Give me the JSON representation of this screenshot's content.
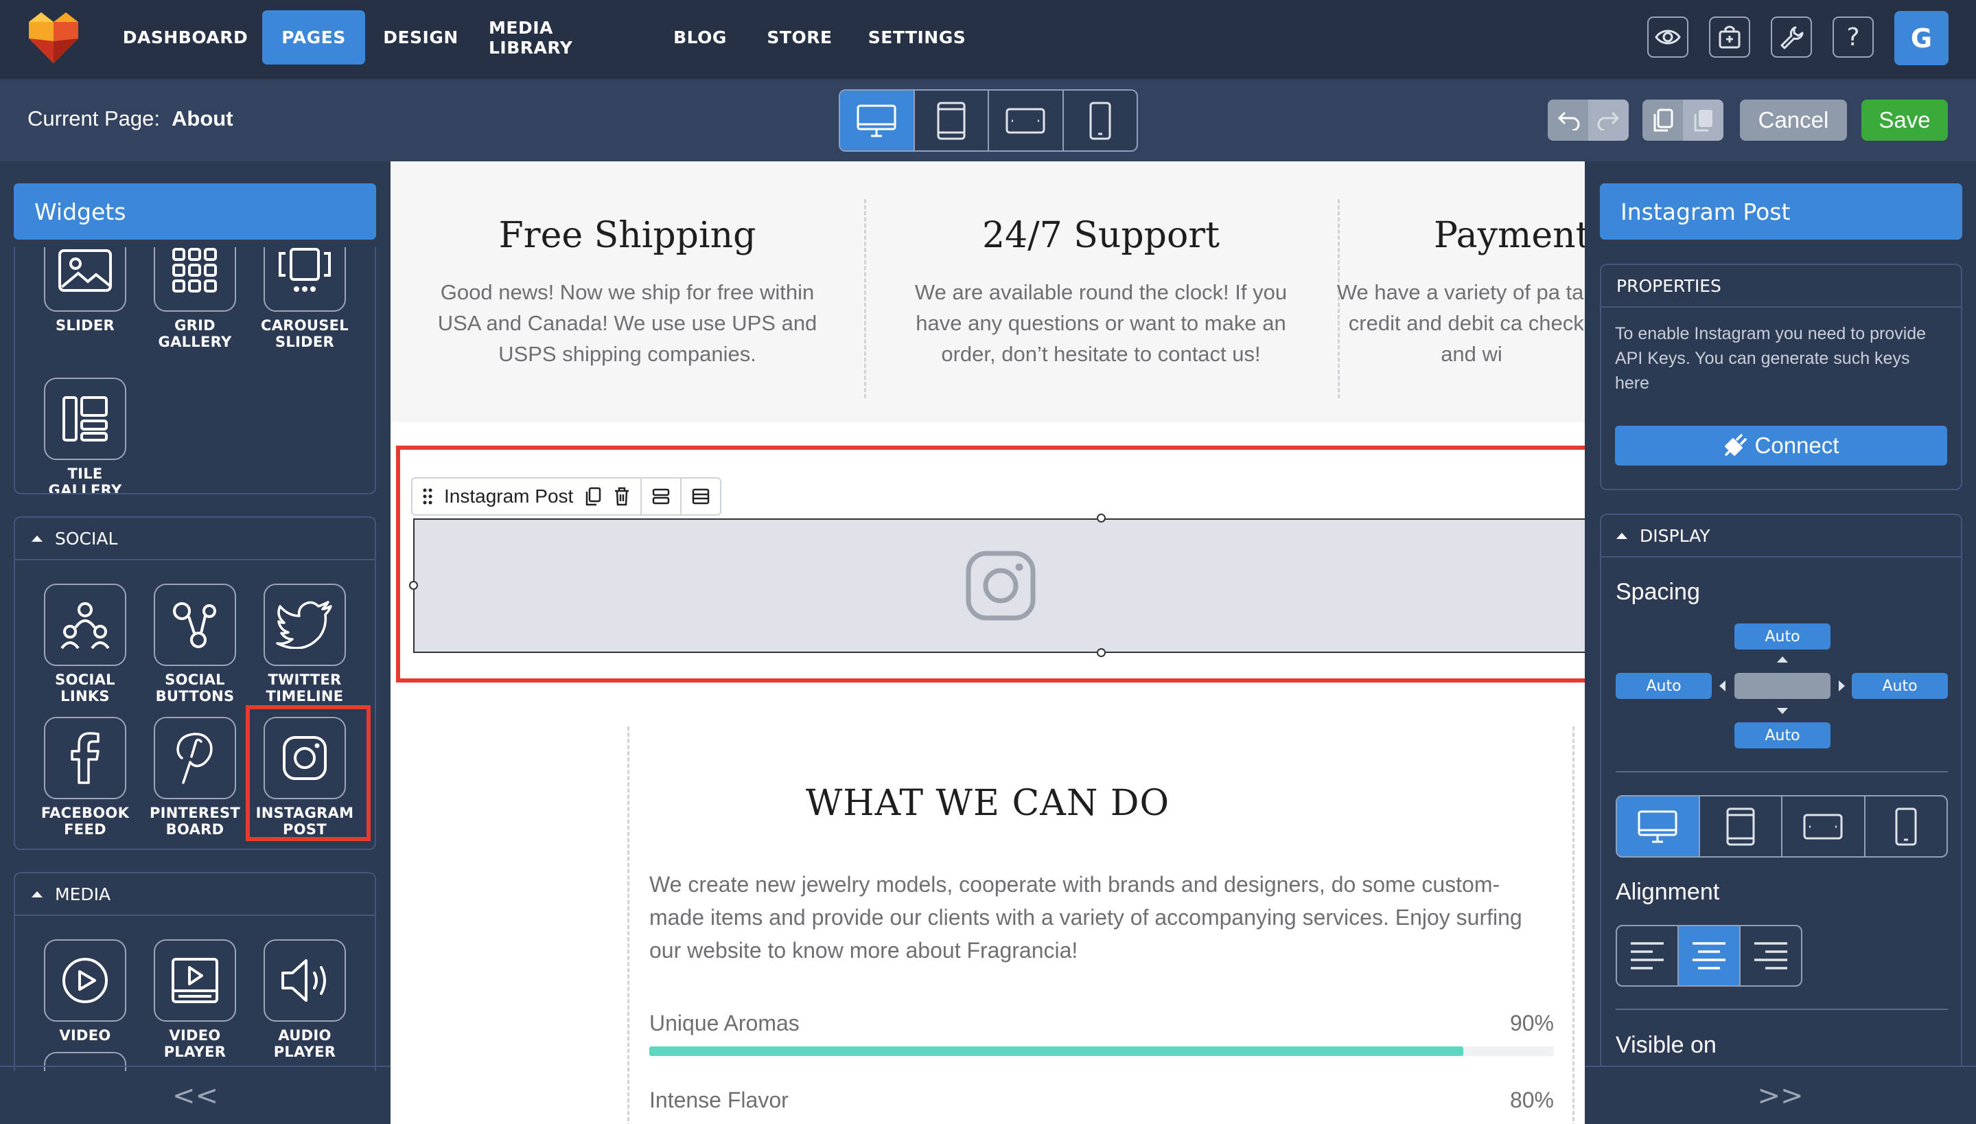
{
  "nav": {
    "items": [
      "DASHBOARD",
      "PAGES",
      "DESIGN",
      "MEDIA LIBRARY",
      "BLOG",
      "STORE",
      "SETTINGS"
    ],
    "active": "PAGES",
    "avatar_letter": "G"
  },
  "subbar": {
    "current_page_label": "Current Page:",
    "current_page": "About",
    "cancel_label": "Cancel",
    "save_label": "Save"
  },
  "left_panel": {
    "title": "Widgets",
    "gallery_widgets": [
      "SLIDER",
      "GRID GALLERY",
      "CAROUSEL SLIDER",
      "TILE GALLERY"
    ],
    "social": {
      "title": "SOCIAL",
      "widgets": [
        "SOCIAL LINKS",
        "SOCIAL BUTTONS",
        "TWITTER TIMELINE",
        "FACEBOOK FEED",
        "PINTEREST BOARD",
        "INSTAGRAM POST"
      ]
    },
    "media": {
      "title": "MEDIA",
      "widgets": [
        "VIDEO",
        "VIDEO PLAYER",
        "AUDIO PLAYER"
      ]
    },
    "collapse": "<<"
  },
  "canvas": {
    "features": [
      {
        "title": "Free Shipping",
        "text": "Good news! Now we ship for free within USA and Canada! We use use UPS and USPS shipping companies."
      },
      {
        "title": "24/7 Support",
        "text": "We are available round the clock! If you have any questions or want to make an order, don’t hesitate to contact us!"
      },
      {
        "title": "Payment",
        "text": "We have a variety of pa take credit and debit ca checks and wi"
      }
    ],
    "instagram_toolbar_label": "Instagram Post",
    "what_title": "WHAT WE CAN DO",
    "what_text": "We create new jewelry models, cooperate with brands and designers, do some custom-made items and provide our clients with a variety of accompanying services. Enjoy surfing our website to know more about Fragrancia!",
    "skills": [
      {
        "label": "Unique Aromas",
        "percent_label": "90%",
        "value": 0.9
      },
      {
        "label": "Intense Flavor",
        "percent_label": "80%",
        "value": 0.8
      }
    ]
  },
  "right_panel": {
    "title": "Instagram Post",
    "properties_title": "PROPERTIES",
    "properties_text": "To enable Instagram you need to provide API Keys. You can generate such keys here",
    "connect_label": "Connect",
    "display_title": "DISPLAY",
    "spacing_label": "Spacing",
    "spacing": {
      "top": "Auto",
      "left": "Auto",
      "right": "Auto",
      "bottom": "Auto"
    },
    "alignment_label": "Alignment",
    "alignment_selected": "center",
    "visible_on_label": "Visible on",
    "collapse": ">>"
  },
  "colors": {
    "accent": "#3d87d8",
    "save": "#3aaa3a",
    "highlight": "#e63b2e",
    "progress": "#5dd6c0",
    "topbar": "#263145",
    "panel": "#2c3a54"
  }
}
